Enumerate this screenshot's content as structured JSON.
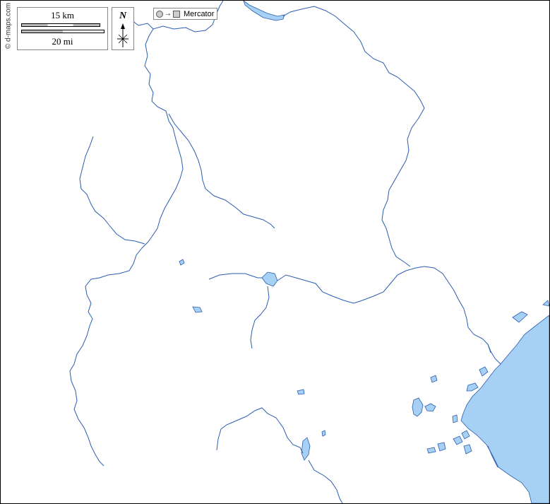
{
  "credit": "© d-maps.com",
  "scale": {
    "km_label": "15 km",
    "mi_label": "20 mi"
  },
  "north": {
    "letter": "N"
  },
  "projection": {
    "label": "Mercator"
  },
  "icons": {
    "globe": "circle-icon",
    "arrow": "right-arrow-icon",
    "flat_map": "square-icon",
    "north_arrow": "compass-star-icon"
  },
  "colors": {
    "water_fill": "#a6d1f5",
    "water_stroke": "#2a5db0",
    "boundary": "#000000",
    "background": "#ffffff"
  }
}
